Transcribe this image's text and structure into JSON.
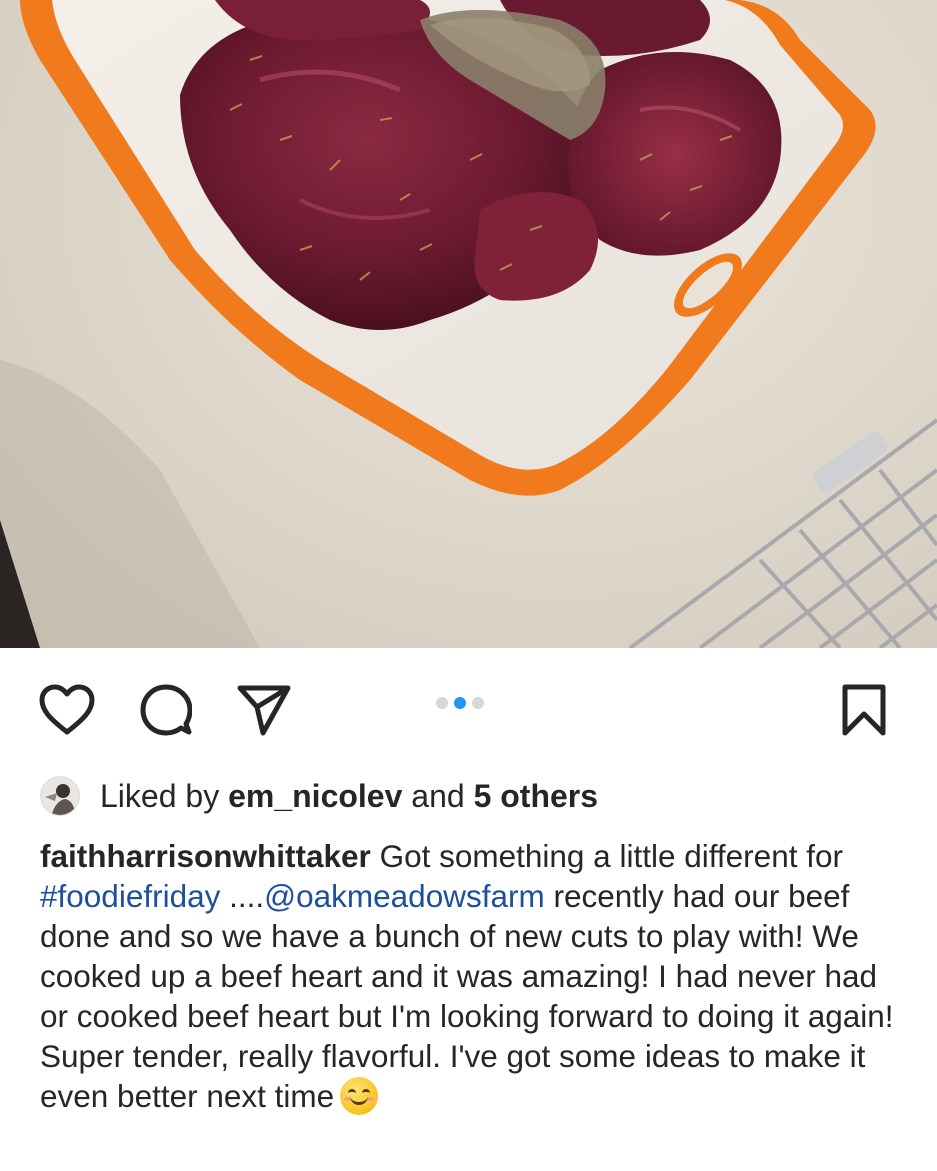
{
  "post": {
    "photo_alt": "Raw beef heart slices seasoned with rosemary on an orange cutting board",
    "carousel": {
      "count": 3,
      "active_index": 1
    }
  },
  "actions": {
    "icons": [
      "heart-icon",
      "comment-icon",
      "share-icon",
      "bookmark-icon"
    ]
  },
  "likes": {
    "prefix": "Liked by ",
    "user": "em_nicolev",
    "middle": " and ",
    "others": "5 others"
  },
  "caption": {
    "username": "faithharrisonwhittaker",
    "text_1": " Got something a little different for ",
    "hashtag": "#foodiefriday",
    "text_2": " ....",
    "mention": "@oakmeadowsfarm",
    "text_3": " recently had our beef done and so we have a bunch of new cuts to play with! We cooked up a beef heart and it was amazing! I had never had or cooked beef heart but I'm looking forward to doing it again! Super tender, really flavorful. I've got some ideas to make it even better next time",
    "emoji": "smiling-face-emoji"
  },
  "colors": {
    "accent_dot": "#2196f3",
    "link": "#1d4f9c",
    "text": "#262626",
    "board": "#f07a1c"
  }
}
